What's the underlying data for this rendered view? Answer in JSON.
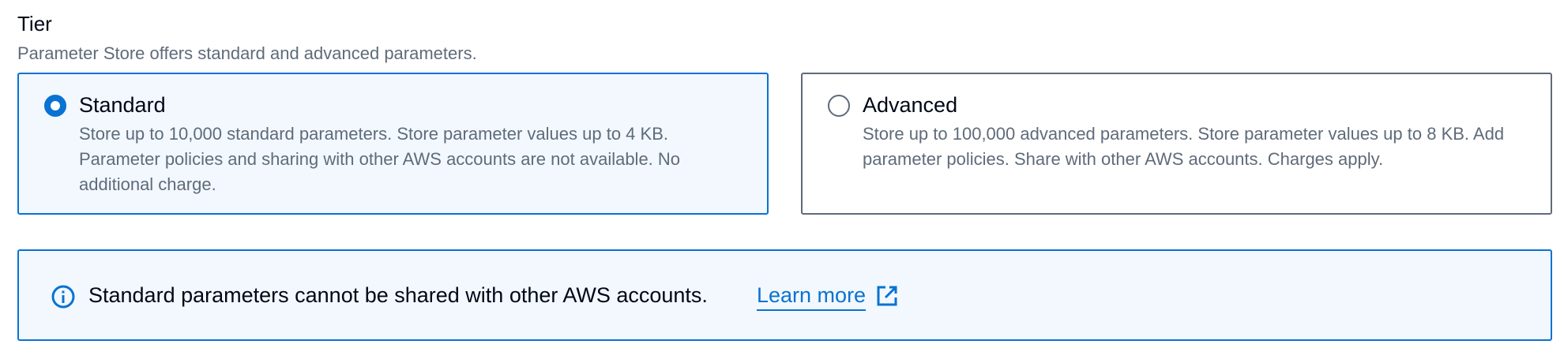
{
  "tier": {
    "label": "Tier",
    "description": "Parameter Store offers standard and advanced parameters."
  },
  "options": [
    {
      "title": "Standard",
      "description": "Store up to 10,000 standard parameters. Store parameter values up to 4 KB. Parameter policies and sharing with other AWS accounts are not available. No additional charge.",
      "selected": true
    },
    {
      "title": "Advanced",
      "description": "Store up to 100,000 advanced parameters. Store parameter values up to 8 KB. Add parameter policies. Share with other AWS accounts. Charges apply.",
      "selected": false
    }
  ],
  "alert": {
    "icon": "info-icon",
    "message": "Standard parameters cannot be shared with other AWS accounts.",
    "link_label": "Learn more",
    "link_icon": "external-link-icon"
  },
  "colors": {
    "accent": "#0972d3",
    "selected_background": "#f2f8fd",
    "muted_text": "#5f6b7a"
  }
}
